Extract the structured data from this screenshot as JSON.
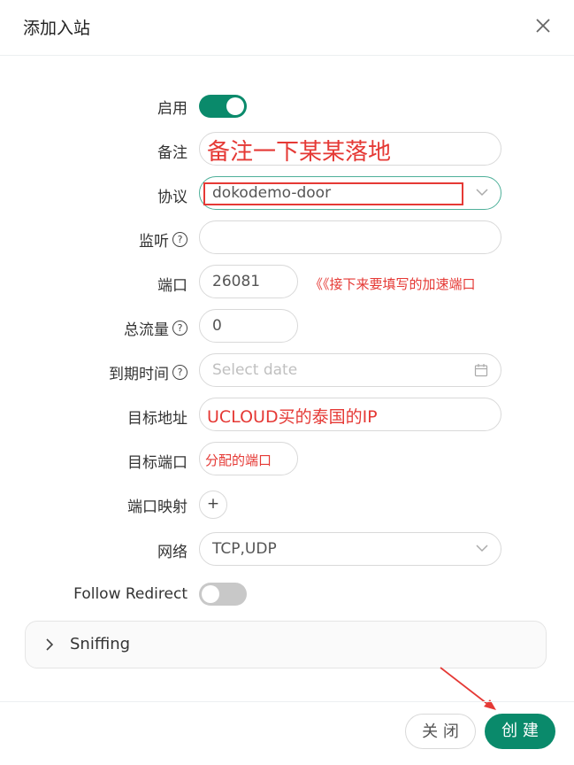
{
  "dialog": {
    "title": "添加入站"
  },
  "form": {
    "enable": {
      "label": "启用",
      "value": true
    },
    "remark": {
      "label": "备注",
      "value": "备注一下某某落地"
    },
    "protocol": {
      "label": "协议",
      "value": "dokodemo-door"
    },
    "listen": {
      "label": "监听",
      "value": ""
    },
    "port": {
      "label": "端口",
      "value": "26081",
      "annotation": "《《接下来要填写的加速端口"
    },
    "total_traffic": {
      "label": "总流量",
      "value": "0"
    },
    "expiry": {
      "label": "到期时间",
      "placeholder": "Select date"
    },
    "target_address": {
      "label": "目标地址",
      "value": "UCLOUD买的泰国的IP"
    },
    "target_port": {
      "label": "目标端口",
      "value": "分配的端口"
    },
    "port_mapping": {
      "label": "端口映射",
      "add_label": "+"
    },
    "network": {
      "label": "网络",
      "value": "TCP,UDP"
    },
    "follow_redirect": {
      "label": "Follow Redirect",
      "value": false
    }
  },
  "sniffing": {
    "label": "Sniffing"
  },
  "footer": {
    "close_label": "关 闭",
    "create_label": "创 建"
  },
  "colors": {
    "accent": "#0a8a6b",
    "annotation_red": "#e53935"
  }
}
